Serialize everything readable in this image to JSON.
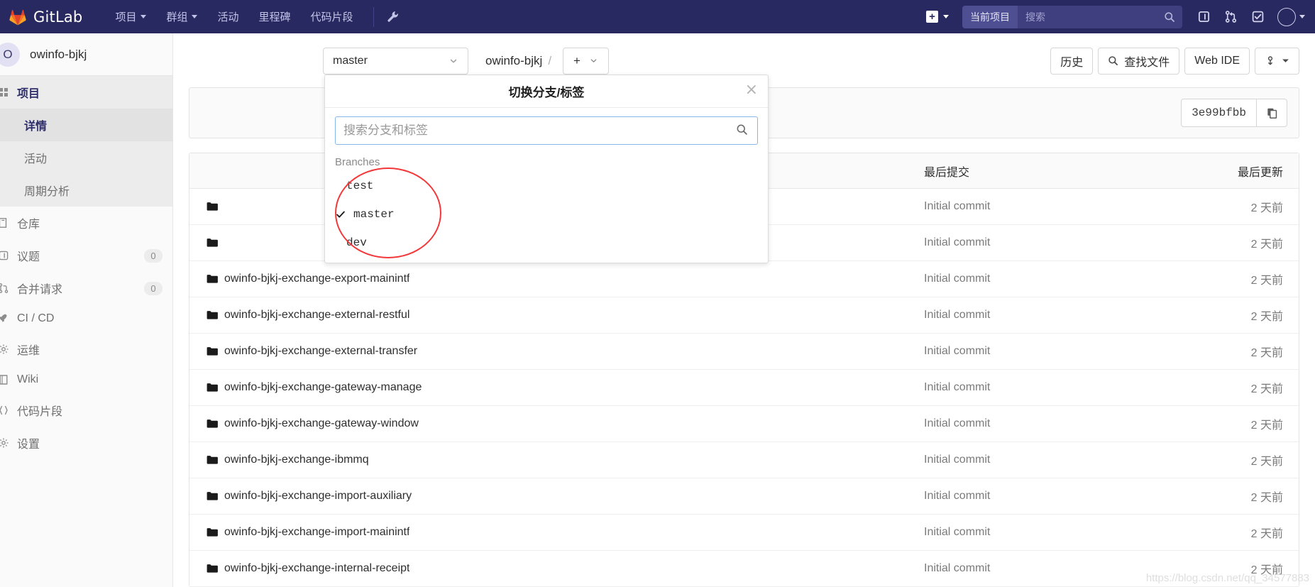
{
  "topnav": {
    "brand": "GitLab",
    "brand_logo_icon": "gitlab-tanuki-logo-icon",
    "links": [
      {
        "label": "项目",
        "icon": "chevron-down-icon",
        "has_caret": true
      },
      {
        "label": "群组",
        "icon": "chevron-down-icon",
        "has_caret": true
      },
      {
        "label": "活动",
        "has_caret": false
      },
      {
        "label": "里程碑",
        "has_caret": false
      },
      {
        "label": "代码片段",
        "has_caret": false
      }
    ],
    "admin_icon": "wrench-icon",
    "create_new_icon": "plus-square-icon",
    "create_new_caret_icon": "chevron-down-icon",
    "search": {
      "scope_label": "当前项目",
      "placeholder": "搜索",
      "value": "",
      "icon": "search-icon"
    },
    "right_icons": [
      {
        "name": "issues-list-icon"
      },
      {
        "name": "merge-requests-icon"
      },
      {
        "name": "todos-check-icon"
      }
    ],
    "avatar_icon": "user-avatar-icon",
    "avatar_caret_icon": "chevron-down-icon",
    "bg_color": "#292961"
  },
  "sidebar": {
    "project": {
      "initial": "O",
      "name": "owinfo-bjkj"
    },
    "group_header": {
      "label": "项目",
      "icon": "project-icon"
    },
    "sub_items": [
      {
        "label": "详情",
        "active": true
      },
      {
        "label": "活动",
        "active": false
      },
      {
        "label": "周期分析",
        "active": false
      }
    ],
    "items": [
      {
        "label": "仓库",
        "icon": "repository-icon",
        "badge": ""
      },
      {
        "label": "议题",
        "icon": "issues-icon",
        "badge": "0"
      },
      {
        "label": "合并请求",
        "icon": "merge-request-icon",
        "badge": "0"
      },
      {
        "label": "CI / CD",
        "icon": "rocket-icon",
        "badge": ""
      },
      {
        "label": "运维",
        "icon": "cog-cloud-icon",
        "badge": ""
      },
      {
        "label": "Wiki",
        "icon": "book-icon",
        "badge": ""
      },
      {
        "label": "代码片段",
        "icon": "snippet-icon",
        "badge": ""
      },
      {
        "label": "设置",
        "icon": "settings-gear-icon",
        "badge": ""
      }
    ]
  },
  "toolbar": {
    "branch_label": "master",
    "branch_caret_icon": "chevron-down-icon",
    "breadcrumb": {
      "repo": "owinfo-bjkj",
      "separator": "/"
    },
    "add_label": "+",
    "add_caret_icon": "chevron-down-icon",
    "history_label": "历史",
    "find_file_label": "查找文件",
    "find_file_icon": "search-icon",
    "web_ide_label": "Web IDE",
    "download_icon": "download-code-icon",
    "download_caret_icon": "caret-down-icon"
  },
  "commit_bar": {
    "hash": "3e99bfbb",
    "copy_icon": "copy-to-clipboard-icon"
  },
  "dropdown": {
    "title": "切换分支/标签",
    "close_icon": "close-icon",
    "search_placeholder": "搜索分支和标签",
    "search_value": "",
    "search_icon": "search-icon",
    "group_label": "Branches",
    "items": [
      {
        "name": "test",
        "selected": false
      },
      {
        "name": "master",
        "selected": true
      },
      {
        "name": "dev",
        "selected": false
      }
    ],
    "check_icon": "checkmark-icon"
  },
  "annotation": {
    "shape": "ellipse",
    "color": "#f2383a"
  },
  "file_table": {
    "columns": {
      "name": "",
      "commit": "最后提交",
      "updated": "最后更新"
    },
    "rows": [
      {
        "name": "owinfo-bjkj-exchange-export-mainintf",
        "icon": "folder-icon",
        "commit": "Initial commit",
        "updated": "2 天前"
      },
      {
        "name": "owinfo-bjkj-exchange-external-restful",
        "icon": "folder-icon",
        "commit": "Initial commit",
        "updated": "2 天前"
      },
      {
        "name": "owinfo-bjkj-exchange-external-transfer",
        "icon": "folder-icon",
        "commit": "Initial commit",
        "updated": "2 天前"
      },
      {
        "name": "owinfo-bjkj-exchange-gateway-manage",
        "icon": "folder-icon",
        "commit": "Initial commit",
        "updated": "2 天前"
      },
      {
        "name": "owinfo-bjkj-exchange-gateway-window",
        "icon": "folder-icon",
        "commit": "Initial commit",
        "updated": "2 天前"
      },
      {
        "name": "owinfo-bjkj-exchange-ibmmq",
        "icon": "folder-icon",
        "commit": "Initial commit",
        "updated": "2 天前"
      },
      {
        "name": "owinfo-bjkj-exchange-import-auxiliary",
        "icon": "folder-icon",
        "commit": "Initial commit",
        "updated": "2 天前"
      },
      {
        "name": "owinfo-bjkj-exchange-import-mainintf",
        "icon": "folder-icon",
        "commit": "Initial commit",
        "updated": "2 天前"
      },
      {
        "name": "owinfo-bjkj-exchange-internal-receipt",
        "icon": "folder-icon",
        "commit": "Initial commit",
        "updated": "2 天前"
      }
    ],
    "hidden_rows_above": [
      {
        "name": "",
        "commit": "Initial commit",
        "updated": "2 天前"
      },
      {
        "name": "",
        "commit": "Initial commit",
        "updated": "2 天前"
      }
    ]
  },
  "watermark": "https://blog.csdn.net/qq_34577883"
}
